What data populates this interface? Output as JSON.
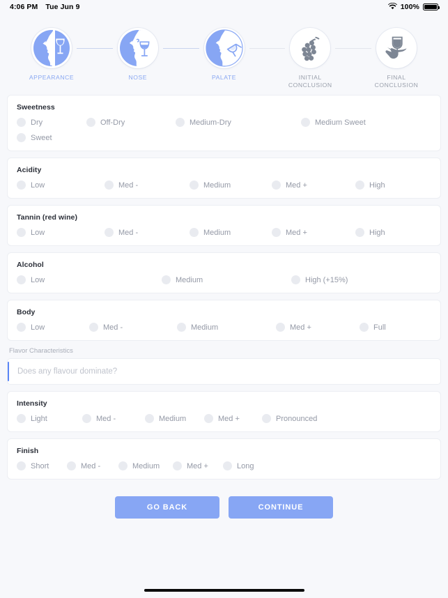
{
  "status_bar": {
    "time": "4:06 PM",
    "date": "Tue Jun 9",
    "battery_percent": "100%",
    "wifi_icon": "wifi-icon",
    "battery_icon": "battery-full-icon"
  },
  "stepper": {
    "active_index": 2,
    "steps": [
      {
        "label": "APPEARANCE",
        "icon": "face-looking-at-wine-glass-icon",
        "state": "done"
      },
      {
        "label": "NOSE",
        "icon": "nose-smelling-wine-glass-icon",
        "state": "done"
      },
      {
        "label": "PALATE",
        "icon": "mouth-tasting-wine-glass-icon",
        "state": "active"
      },
      {
        "label": "INITIAL\nCONCLUSION",
        "label_line1": "INITIAL",
        "label_line2": "CONCLUSION",
        "icon": "grapes-icon",
        "state": "upcoming"
      },
      {
        "label": "FINAL\nCONCLUSION",
        "label_line1": "FINAL",
        "label_line2": "CONCLUSION",
        "icon": "hand-holding-wine-glass-icon",
        "state": "upcoming"
      }
    ]
  },
  "form": {
    "sweetness": {
      "title": "Sweetness",
      "options": [
        "Dry",
        "Off-Dry",
        "Medium-Dry",
        "Medium Sweet",
        "Sweet"
      ],
      "selected": null
    },
    "acidity": {
      "title": "Acidity",
      "options": [
        "Low",
        "Med -",
        "Medium",
        "Med +",
        "High"
      ],
      "selected": null
    },
    "tannin": {
      "title": "Tannin (red wine)",
      "options": [
        "Low",
        "Med -",
        "Medium",
        "Med +",
        "High"
      ],
      "selected": null
    },
    "alcohol": {
      "title": "Alcohol",
      "options": [
        "Low",
        "Medium",
        "High (+15%)"
      ],
      "selected": null
    },
    "body": {
      "title": "Body",
      "options": [
        "Low",
        "Med -",
        "Medium",
        "Med +",
        "Full"
      ],
      "selected": null
    },
    "flavor": {
      "label": "Flavor Characteristics",
      "placeholder": "Does any flavour dominate?",
      "value": ""
    },
    "intensity": {
      "title": "Intensity",
      "options": [
        "Light",
        "Med -",
        "Medium",
        "Med +",
        "Pronounced"
      ],
      "selected": null
    },
    "finish": {
      "title": "Finish",
      "options": [
        "Short",
        "Med -",
        "Medium",
        "Med +",
        "Long"
      ],
      "selected": null
    }
  },
  "actions": {
    "back_label": "GO BACK",
    "continue_label": "CONTINUE"
  },
  "colors": {
    "accent": "#87a6f4",
    "page_bg": "#f7f8fb",
    "card_bg": "#ffffff",
    "radio_bg": "#e9ebf0",
    "muted_text": "#9499a6",
    "caret": "#5a86f7"
  }
}
